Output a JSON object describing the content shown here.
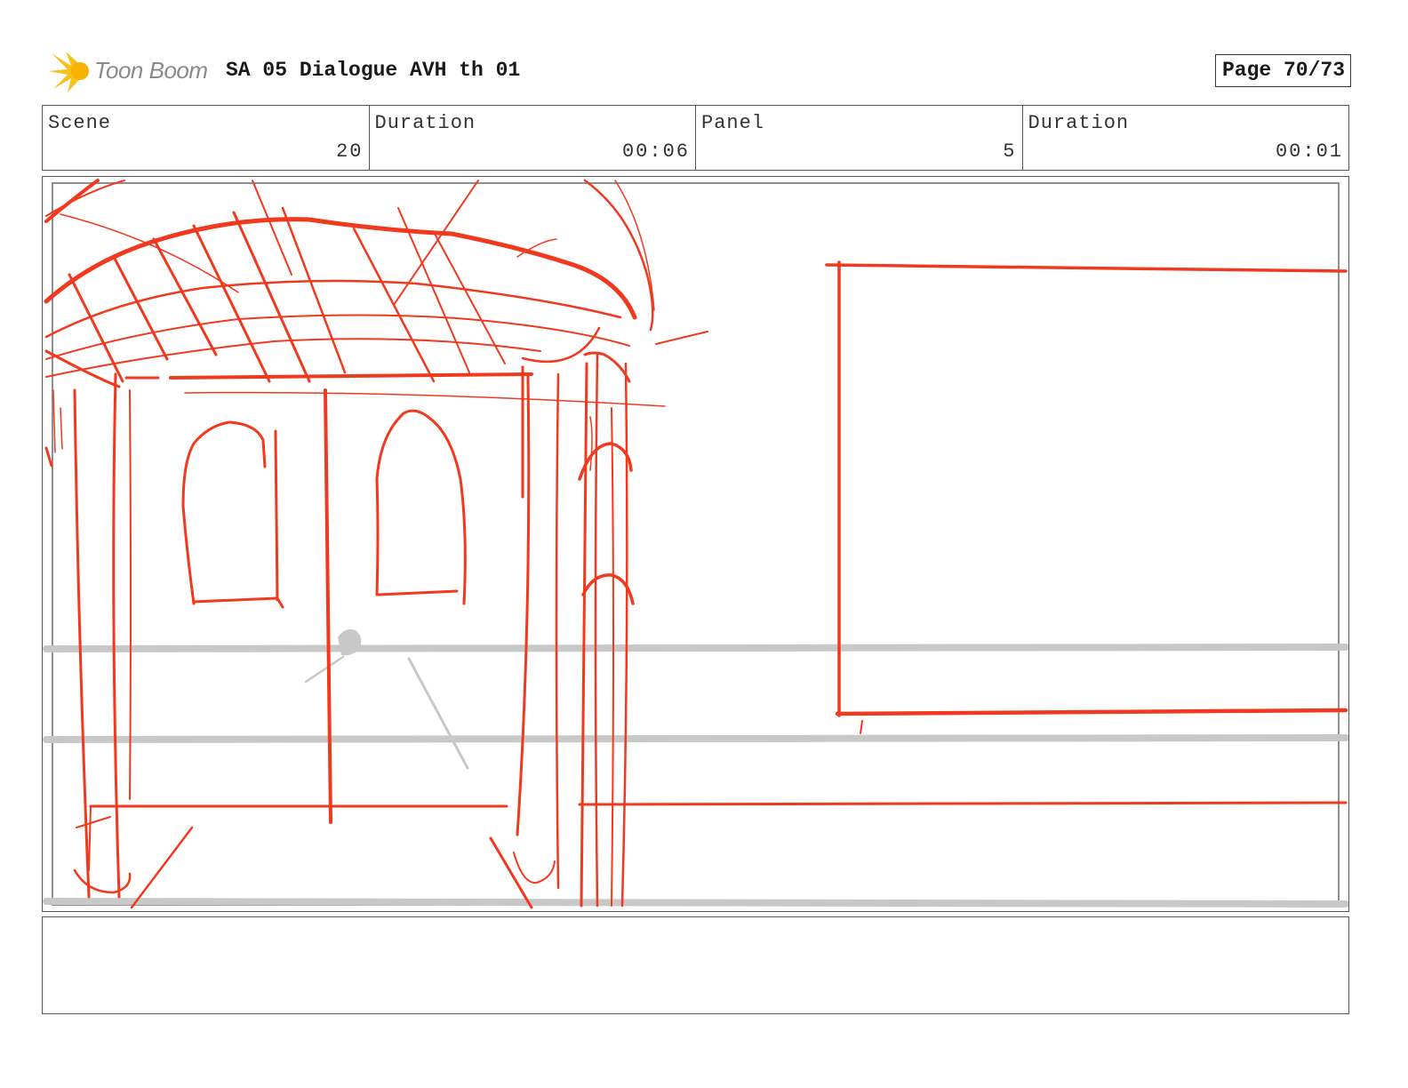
{
  "header": {
    "logo_text": "Toon Boom",
    "title": "SA 05 Dialogue AVH th 01",
    "page": "Page 70/73"
  },
  "info": {
    "scene_label": "Scene",
    "scene_value": "20",
    "scene_duration_label": "Duration",
    "scene_duration_value": "00:06",
    "panel_label": "Panel",
    "panel_value": "5",
    "panel_duration_label": "Duration",
    "panel_duration_value": "00:01"
  },
  "colors": {
    "sketch": "#f0391e",
    "guide": "#c8c8c8",
    "logo_yellow": "#f7c21b",
    "logo_text": "#8a8a8a"
  },
  "notes": {
    "text": ""
  }
}
